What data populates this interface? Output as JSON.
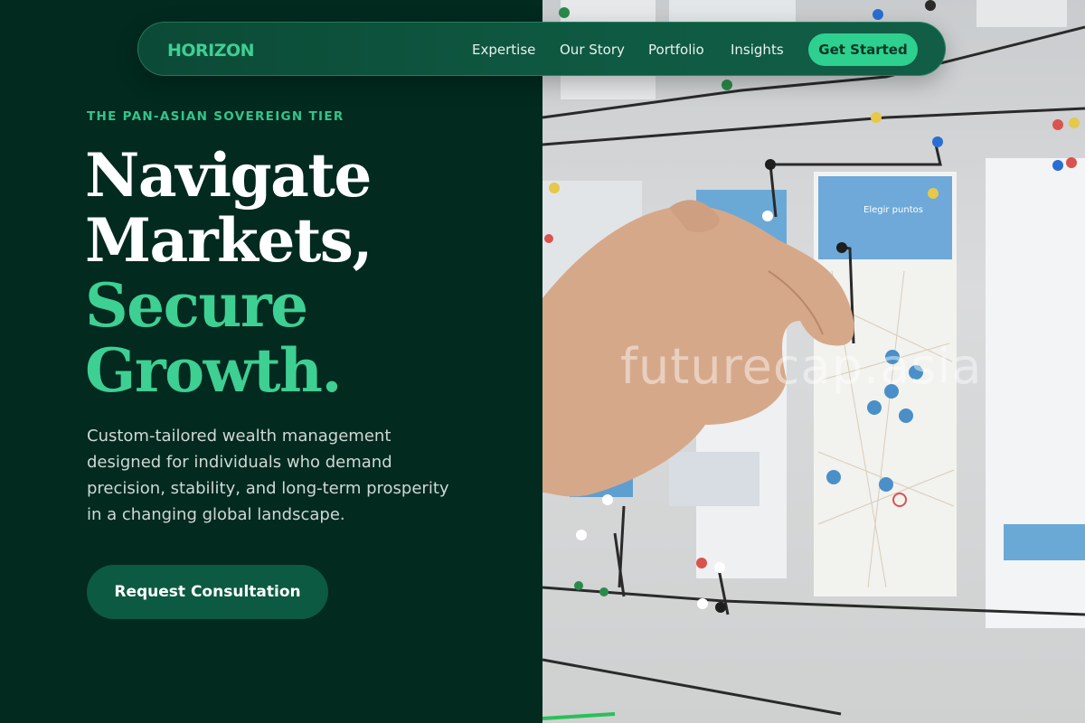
{
  "nav": {
    "logo": "HORIZON",
    "links": [
      "Expertise",
      "Our Story",
      "Portfolio",
      "Insights"
    ],
    "cta": "Get Started"
  },
  "hero": {
    "eyebrow": "THE PAN-ASIAN SOVEREIGN TIER",
    "headline_line1": "Navigate",
    "headline_line2": "Markets,",
    "headline_line3": "Secure",
    "headline_line4": "Growth.",
    "description": "Custom-tailored wealth management designed for individuals who demand precision, stability, and long-term prosperity in a changing global landscape.",
    "cta": "Request Consultation"
  },
  "photo": {
    "watermark": "futurecap.asia",
    "card_title": "Elegir puntos"
  },
  "colors": {
    "background": "#022a1f",
    "accent": "#3ecf93",
    "nav_bg": "#0f5a42",
    "cta_bg": "#0c5a41"
  }
}
